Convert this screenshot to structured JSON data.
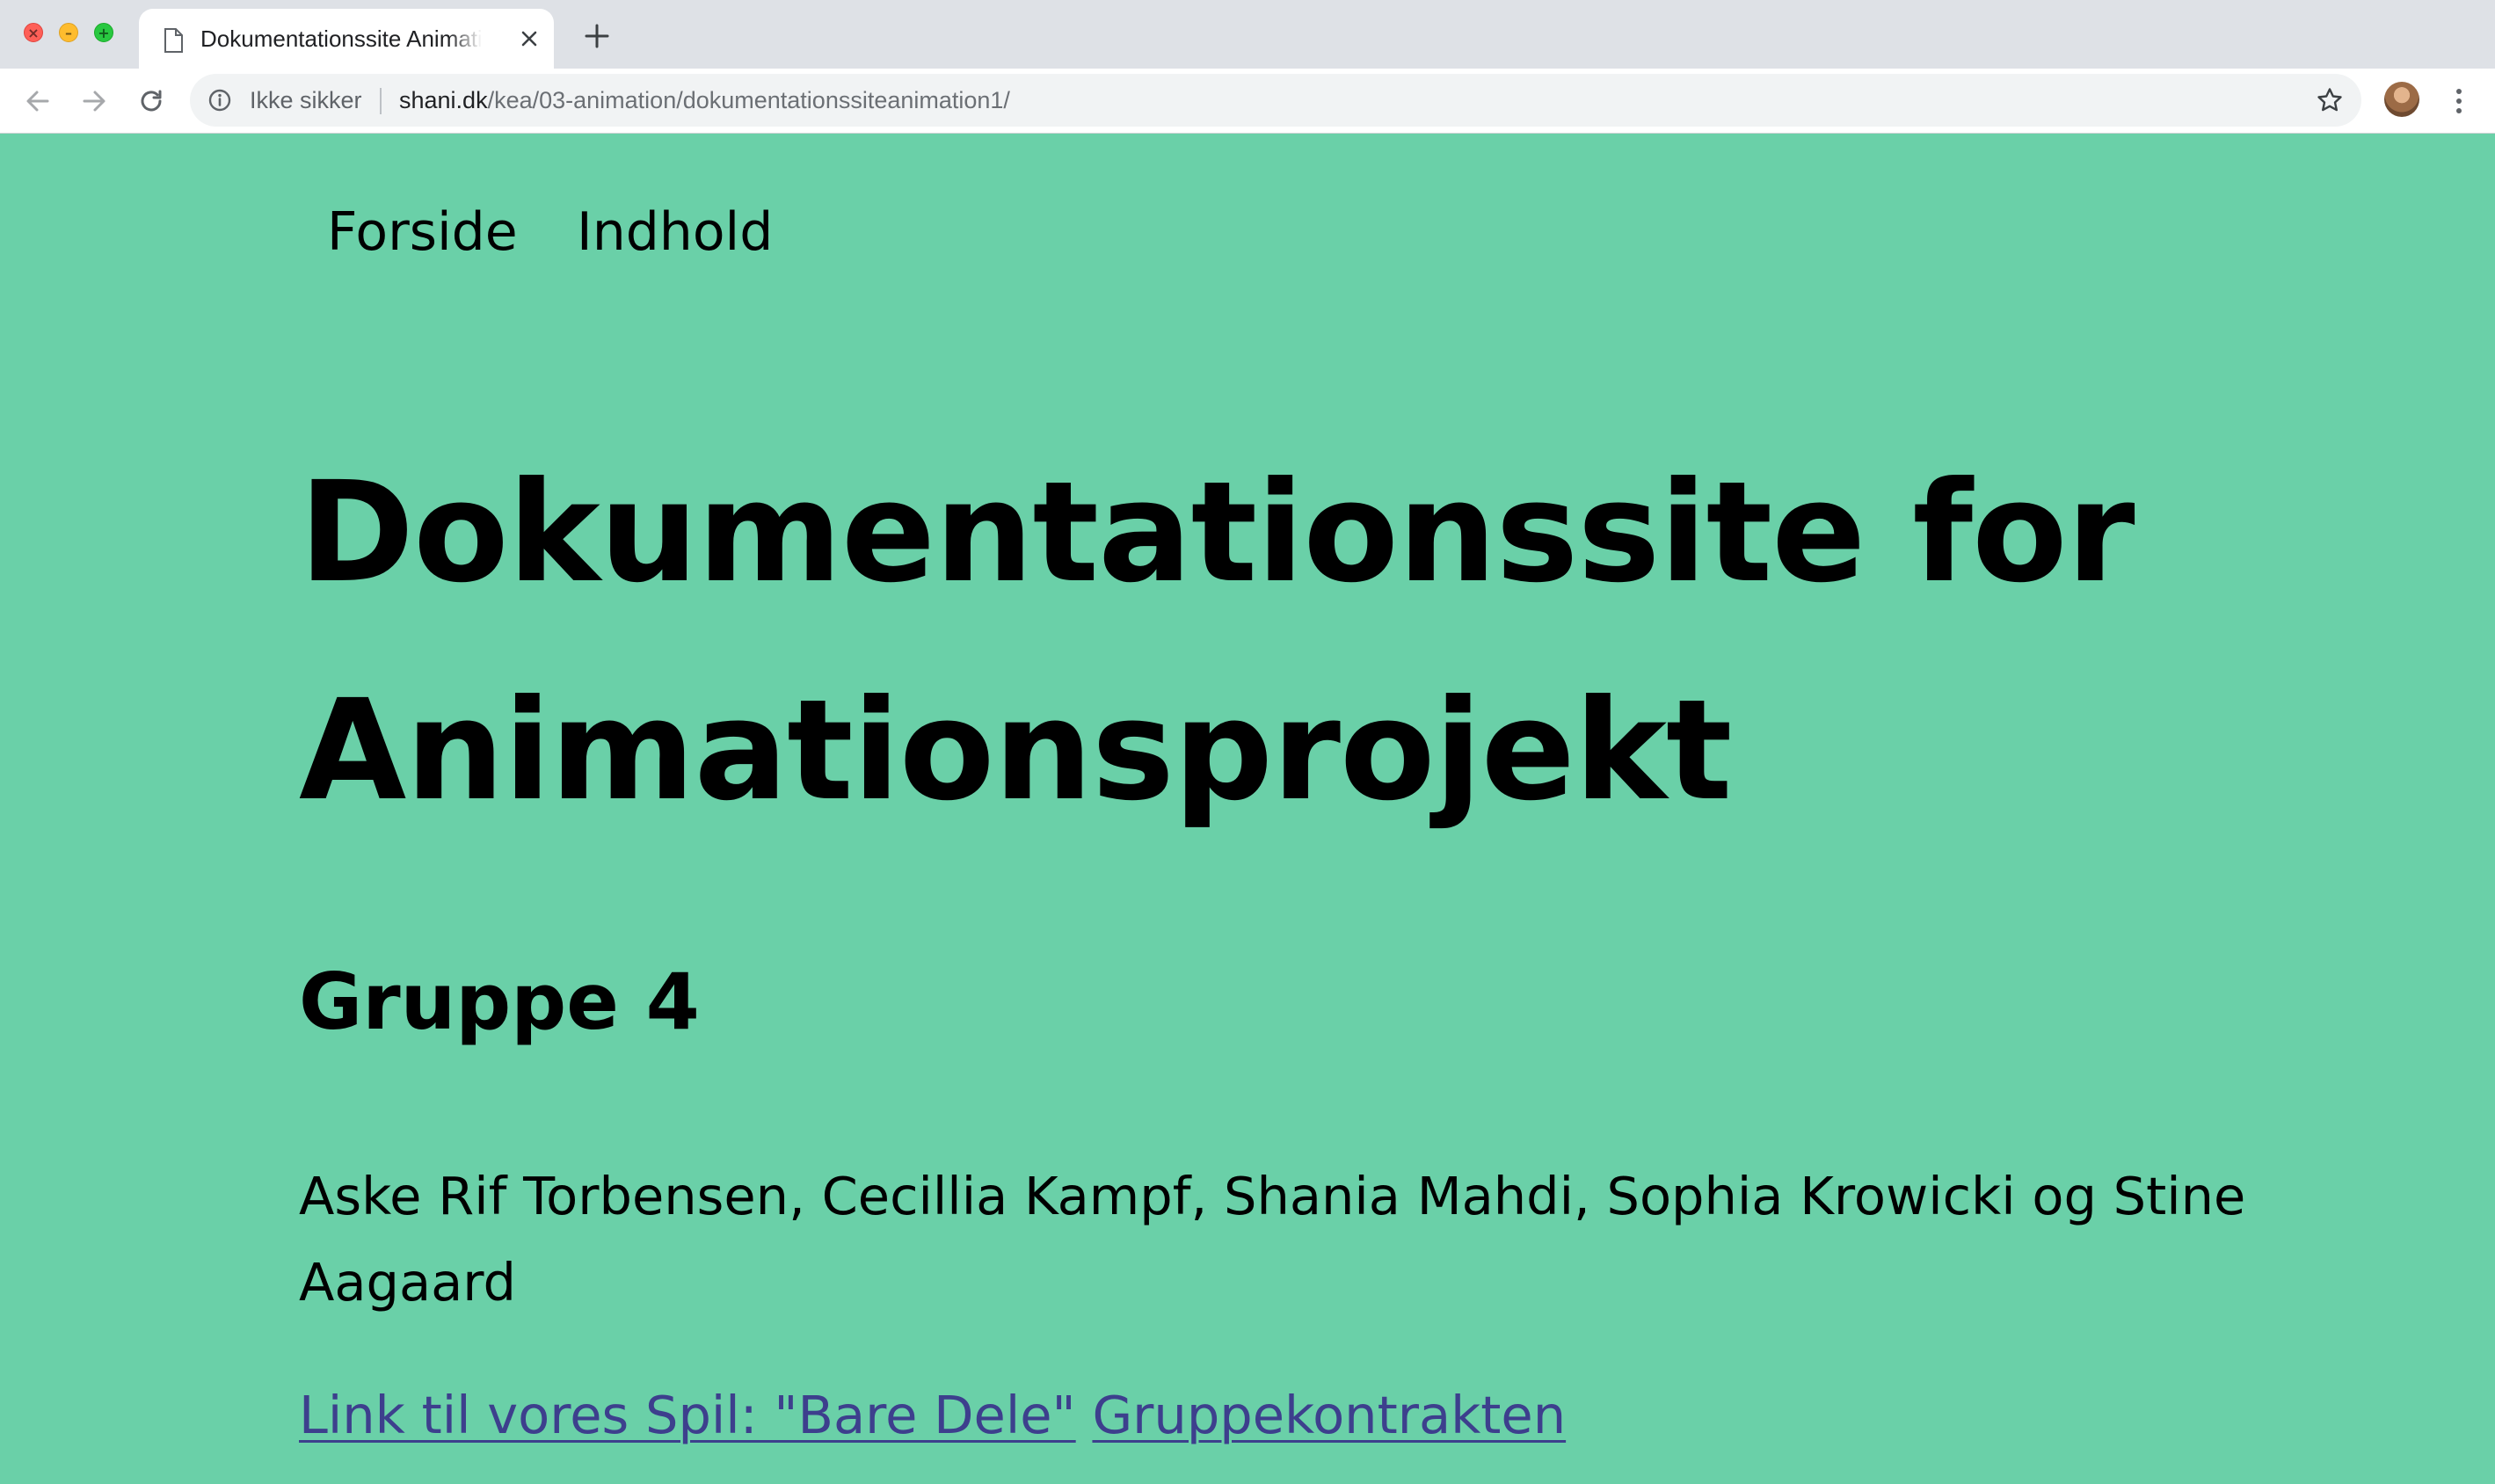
{
  "browser": {
    "tab": {
      "title": "Dokumentationssite Animationsprojekt",
      "close_icon": "close-icon",
      "favicon": "document-icon"
    },
    "new_tab_icon": "plus-icon",
    "toolbar": {
      "back_icon": "arrow-left-icon",
      "forward_icon": "arrow-right-icon",
      "reload_icon": "reload-icon"
    },
    "omnibox": {
      "security_label": "Ikke sikker",
      "url_host": "shani.dk",
      "url_path": "/kea/03-animation/dokumentationssiteanimation1/",
      "bookmark_icon": "star-icon"
    },
    "profile_icon": "avatar",
    "menu_icon": "more-vertical-icon"
  },
  "page": {
    "background_color": "#6ad0a8",
    "link_color": "#3d3f8d",
    "nav": {
      "items": [
        {
          "label": "Forside"
        },
        {
          "label": "Indhold"
        }
      ]
    },
    "heading": "Dokumentationssite for Animationsprojekt",
    "group_title": "Gruppe 4",
    "members": "Aske Rif Torbensen, Cecillia Kampf, Shania Mahdi, Sophia Krowicki og Stine Aagaard",
    "links": [
      {
        "label": "Link til vores Spil: \"Bare Dele\""
      },
      {
        "label": "Gruppekontrakten"
      }
    ]
  }
}
